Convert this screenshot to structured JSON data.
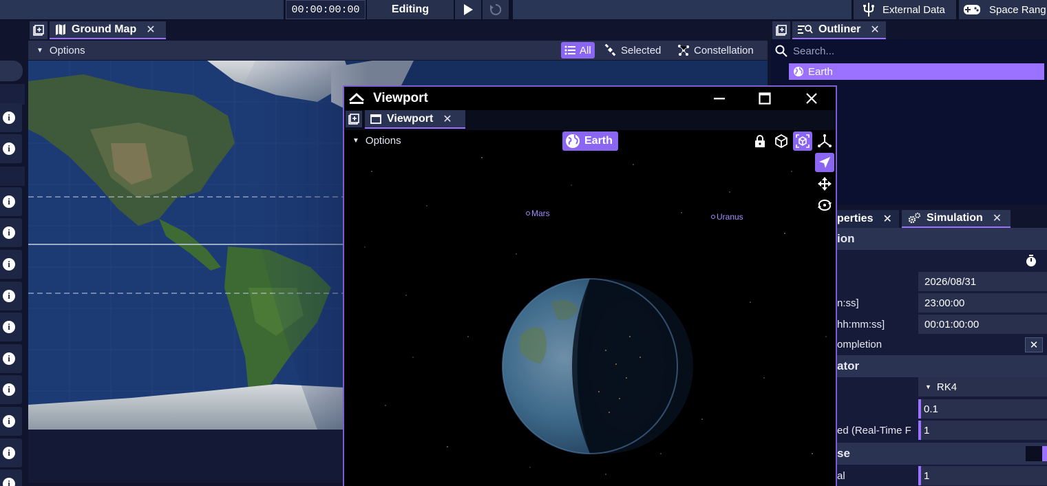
{
  "topbar": {
    "timecode": "00:00:00:00",
    "mode": "Editing",
    "external_data": "External Data",
    "space_range": "Space Rang"
  },
  "ground_map": {
    "tab_label": "Ground Map",
    "options_label": "Options",
    "filters": [
      {
        "label": "All",
        "active": true
      },
      {
        "label": "Selected",
        "active": false
      },
      {
        "label": "Constellation",
        "active": false
      }
    ]
  },
  "outliner": {
    "tab_label": "Outliner",
    "search_placeholder": "Search...",
    "items": [
      {
        "label": "Earth",
        "selected": true
      }
    ]
  },
  "viewport": {
    "window_title": "Viewport",
    "tab_label": "Viewport",
    "options_label": "Options",
    "focus_label": "Earth",
    "planet_labels": [
      "Mars",
      "Uranus"
    ]
  },
  "properties_panel": {
    "tab_properties": "perties",
    "tab_simulation": "Simulation",
    "sections": [
      {
        "title": "ion"
      },
      {
        "title": "ator"
      },
      {
        "title": "se"
      }
    ],
    "rows": [
      {
        "label": "",
        "value": "2026/08/31"
      },
      {
        "label": "n:ss]",
        "value": "23:00:00"
      },
      {
        "label": "hh:mm:ss]",
        "value": "00:01:00:00"
      },
      {
        "label": "ompletion",
        "value": ""
      },
      {
        "label": "",
        "value": "RK4"
      },
      {
        "label": "",
        "value": "0.1"
      },
      {
        "label": "ed (Real-Time F",
        "value": "1"
      },
      {
        "label": "al",
        "value": "1"
      }
    ]
  },
  "colors": {
    "accent": "#9a72ff",
    "panel": "#28304e",
    "background": "#10142c"
  }
}
